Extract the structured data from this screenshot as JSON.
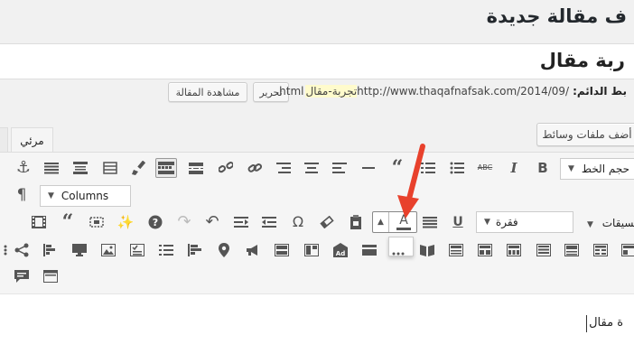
{
  "header": {
    "page_title": "ف مقالة جديدة"
  },
  "post": {
    "title": "ربة مقال",
    "content_text": "ة مقال"
  },
  "permalink": {
    "label": "بط الدائم:",
    "url_prefix": "http://www.thaqafnafsak.com/2014/09/",
    "slug": "تجربة-مقال",
    "url_suffix": ".html",
    "edit_label": "تحرير",
    "view_label": "مشاهدة المقالة"
  },
  "media": {
    "add_media_label": "أضف ملفات وسائط"
  },
  "tabs": {
    "visual": "مرئي"
  },
  "toolbar": {
    "font_size_select": "حجم الخط",
    "columns_select": "Columns",
    "paragraph_select": "فقرة",
    "formats_label": "نسيقات"
  },
  "colors": {
    "accent": "#0073aa",
    "arrow": "#e8412c",
    "toolbar_bg": "#f5f5f5",
    "page_bg": "#f1f1f1"
  }
}
